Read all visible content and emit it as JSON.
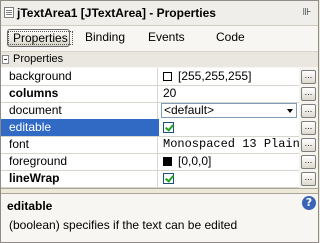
{
  "window": {
    "title": "jTextArea1 [JTextArea] - Properties",
    "close_glyph": "⊪"
  },
  "tabs": [
    {
      "label": "Properties",
      "active": true
    },
    {
      "label": "Binding",
      "active": false
    },
    {
      "label": "Events",
      "active": false
    },
    {
      "label": "Code",
      "active": false
    }
  ],
  "section": {
    "label": "Properties"
  },
  "properties": [
    {
      "name": "background",
      "value": "[255,255,255]",
      "swatch": "#ffffff",
      "bold": false
    },
    {
      "name": "columns",
      "value": "20",
      "bold": true
    },
    {
      "name": "document",
      "value": "<default>",
      "bold": false
    },
    {
      "name": "editable",
      "value": "",
      "checked": true,
      "bold": false,
      "selected": true
    },
    {
      "name": "font",
      "value": "Monospaced 13 Plain",
      "bold": false
    },
    {
      "name": "foreground",
      "value": "[0,0,0]",
      "swatch": "#000000",
      "bold": false
    },
    {
      "name": "lineWrap",
      "value": "",
      "checked": true,
      "bold": true
    }
  ],
  "help": {
    "title": "editable",
    "description": "(boolean) specifies if the text can be edited",
    "icon": "?"
  },
  "colors": {
    "selection": "#316ac5",
    "chrome": "#ece9d8"
  }
}
